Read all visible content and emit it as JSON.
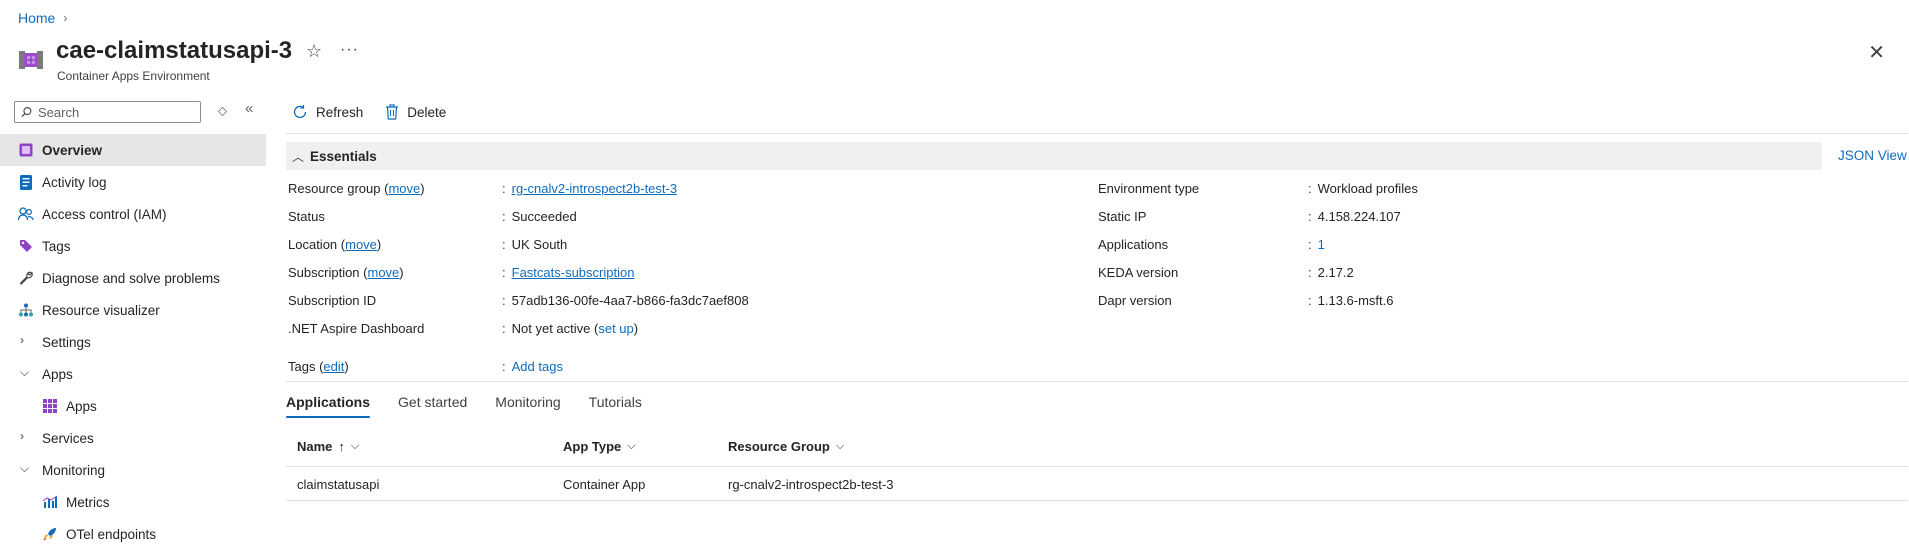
{
  "breadcrumb": {
    "home": "Home"
  },
  "header": {
    "title": "cae-claimstatusapi-3",
    "subtitle": "Container Apps Environment"
  },
  "sidebar": {
    "search_placeholder": "Search",
    "items": [
      {
        "label": "Overview",
        "icon": "overview-icon",
        "active": true
      },
      {
        "label": "Activity log",
        "icon": "activity-log-icon"
      },
      {
        "label": "Access control (IAM)",
        "icon": "people-icon"
      },
      {
        "label": "Tags",
        "icon": "tag-icon"
      },
      {
        "label": "Diagnose and solve problems",
        "icon": "wrench-icon"
      },
      {
        "label": "Resource visualizer",
        "icon": "hierarchy-icon"
      },
      {
        "label": "Settings",
        "expanded": false
      },
      {
        "label": "Apps",
        "expanded": true
      },
      {
        "label": "Apps",
        "icon": "grid-icon",
        "sub": true
      },
      {
        "label": "Services",
        "expanded": false
      },
      {
        "label": "Monitoring",
        "expanded": true
      },
      {
        "label": "Metrics",
        "icon": "metrics-icon",
        "sub": true
      },
      {
        "label": "OTel endpoints",
        "icon": "rocket-icon",
        "sub": true
      }
    ]
  },
  "toolbar": {
    "refresh": "Refresh",
    "delete": "Delete"
  },
  "essentials": {
    "title": "Essentials",
    "json_view": "JSON View",
    "left": {
      "resource_group": {
        "label": "Resource group",
        "action": "move",
        "value": "rg-cnalv2-introspect2b-test-3"
      },
      "status": {
        "label": "Status",
        "value": "Succeeded"
      },
      "location": {
        "label": "Location",
        "action": "move",
        "value": "UK South"
      },
      "subscription": {
        "label": "Subscription",
        "action": "move",
        "value": "Fastcats-subscription"
      },
      "subscription_id": {
        "label": "Subscription ID",
        "value": "57adb136-00fe-4aa7-b866-fa3dc7aef808"
      },
      "aspire": {
        "label": ".NET Aspire Dashboard",
        "value": "Not yet active",
        "action": "set up"
      }
    },
    "right": {
      "env_type": {
        "label": "Environment type",
        "value": "Workload profiles"
      },
      "static_ip": {
        "label": "Static IP",
        "value": "4.158.224.107"
      },
      "applications": {
        "label": "Applications",
        "value": "1"
      },
      "keda": {
        "label": "KEDA version",
        "value": "2.17.2"
      },
      "dapr": {
        "label": "Dapr version",
        "value": "1.13.6-msft.6"
      }
    },
    "tags": {
      "label": "Tags",
      "action": "edit",
      "value": "Add tags"
    }
  },
  "tabs": [
    "Applications",
    "Get started",
    "Monitoring",
    "Tutorials"
  ],
  "table": {
    "columns": [
      "Name",
      "App Type",
      "Resource Group"
    ],
    "rows": [
      {
        "name": "claimstatusapi",
        "app_type": "Container App",
        "resource_group": "rg-cnalv2-introspect2b-test-3"
      }
    ]
  },
  "colors": {
    "accent": "#0f6cbd",
    "active_nav": "#e6e6e6",
    "essentials_bar": "#f0f0f0"
  }
}
